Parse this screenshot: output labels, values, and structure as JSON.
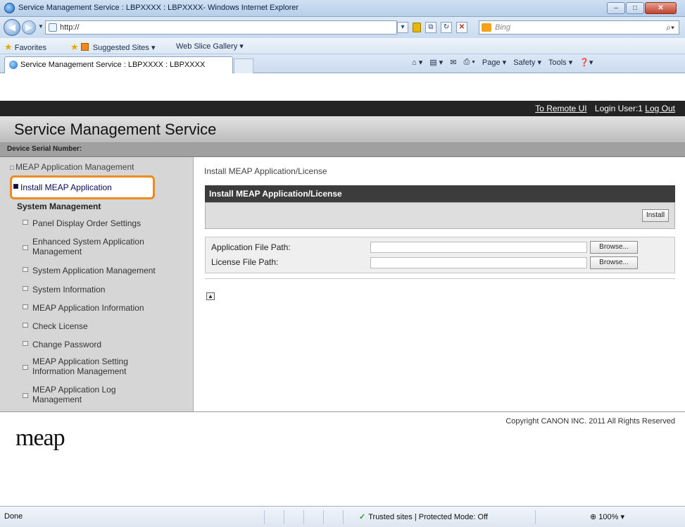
{
  "window": {
    "title": "Service Management Service : LBPXXXX : LBPXXXX- Windows Internet Explorer",
    "min": "–",
    "max": "□",
    "close": "✕"
  },
  "address": {
    "url": "http://",
    "search_placeholder": "Bing"
  },
  "favorites": {
    "favorites_label": "Favorites",
    "suggested_sites": "Suggested Sites ▾",
    "web_slice_gallery": "Web Slice Gallery ▾"
  },
  "tab": {
    "label": "Service Management Service : LBPXXXX : LBPXXXX"
  },
  "command_bar": {
    "page": "Page ▾",
    "safety": "Safety ▾",
    "tools": "Tools ▾",
    "help": "❓▾"
  },
  "header": {
    "remote_ui": "To Remote UI",
    "login_user": "Login User:1",
    "logout": "Log Out",
    "title": "Service Management Service",
    "serial_label": "Device Serial Number:"
  },
  "sidebar": {
    "meap_app_management": "MEAP Application Management",
    "install_meap_application": "Install MEAP Application",
    "system_management": "System Management",
    "items": [
      "Panel Display Order Settings",
      "Enhanced System Application Management",
      "System Application Management",
      "System Information",
      "MEAP Application Information",
      "Check License",
      "Change Password",
      "MEAP Application Setting Information Management",
      "MEAP Application Log Management"
    ]
  },
  "main": {
    "breadcrumb": "Install MEAP Application/License",
    "panel_title": "Install MEAP Application/License",
    "install_button": "Install",
    "app_file_label": "Application File Path:",
    "license_file_label": "License File Path:",
    "browse_button": "Browse..."
  },
  "footer": {
    "copyright": "Copyright CANON INC. 2011 All Rights Reserved",
    "logo": "meap"
  },
  "status": {
    "text": "Done",
    "zone": "Trusted sites | Protected Mode: Off",
    "zoom": "100%"
  }
}
